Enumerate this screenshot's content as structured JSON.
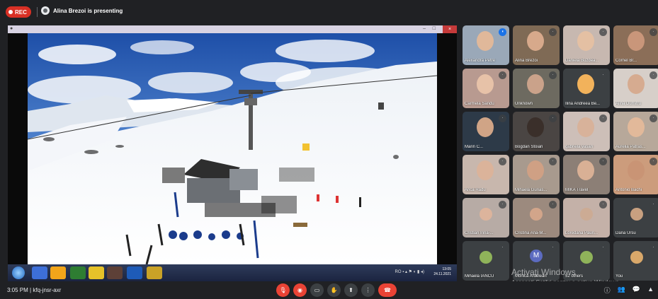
{
  "topbar": {
    "rec_label": "REC",
    "presenter_text": "Alina Brezoi is presenting"
  },
  "presentation": {
    "clock_time": "13:05",
    "clock_date": "24.11.2021",
    "tray_text": "RO"
  },
  "participants": [
    {
      "name": "Alexandra Petre",
      "speaking": true
    },
    {
      "name": "Alina Brezoi",
      "speaking": false
    },
    {
      "name": "Daniela Buzdea...",
      "speaking": false
    },
    {
      "name": "Cornel Br...",
      "speaking": false
    },
    {
      "name": "Carmela Sandu",
      "speaking": false
    },
    {
      "name": "Unknown",
      "speaking": false
    },
    {
      "name": "Ilina Andreea Be...",
      "speaking": false
    },
    {
      "name": "Alina Dumitru",
      "speaking": false
    },
    {
      "name": "Marin C...",
      "speaking": false
    },
    {
      "name": "Bogdan Stoian",
      "speaking": false
    },
    {
      "name": "gabriela vasan",
      "speaking": false
    },
    {
      "name": "Aurelia Patras...",
      "speaking": false
    },
    {
      "name": "Anca Radu",
      "speaking": false
    },
    {
      "name": "Mihaela Gurias...",
      "speaking": false
    },
    {
      "name": "MIKA Travel",
      "speaking": false
    },
    {
      "name": "Antonio Bachi",
      "speaking": false
    },
    {
      "name": "Cristian Irina-...",
      "speaking": false
    },
    {
      "name": "Cristina Ana-M...",
      "speaking": false
    },
    {
      "name": "Loredana Paun...",
      "speaking": false
    },
    {
      "name": "Dana Ursu",
      "speaking": false
    },
    {
      "name": "Mihaela IANCU",
      "speaking": false
    },
    {
      "name": "Monica Ardelean",
      "speaking": false,
      "initial": "M"
    },
    {
      "name": "52 others",
      "speaking": false
    },
    {
      "name": "You",
      "speaking": false
    }
  ],
  "bottombar": {
    "time": "3:05 PM",
    "separator": "|",
    "meeting_code": "kfq-jnsr-axr"
  },
  "watermark": {
    "line1": "Activați Windows",
    "line2": "Accesați Setări pentru a activa Windows."
  },
  "colors": {
    "background": "#202124",
    "danger": "#ea4335",
    "accent": "#1a73e8"
  }
}
